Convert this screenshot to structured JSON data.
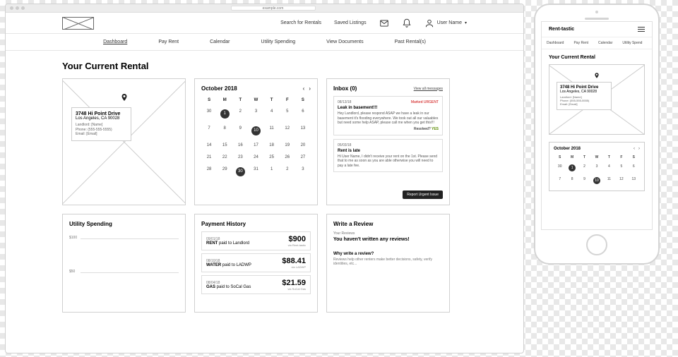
{
  "browser": {
    "url": "example.com"
  },
  "topnav": {
    "search": "Search for Rentals",
    "saved": "Saved Listings",
    "user": "User Name"
  },
  "subnav": [
    "Dashboard",
    "Pay Rent",
    "Calendar",
    "Utility Spending",
    "View Documents",
    "Past Rental(s)"
  ],
  "heading": "Your Current Rental",
  "address": {
    "line1": "3748 Hi Point Drive",
    "line2": "Los Angeles, CA 90028",
    "landlord": "Landlord: [Name]",
    "phone": "Phone: (555-555-5555)",
    "email": "Email: [Email]"
  },
  "calendar": {
    "month": "October 2018",
    "dow": [
      "S",
      "M",
      "T",
      "W",
      "T",
      "F",
      "S"
    ],
    "rows": [
      [
        "30",
        "1",
        "2",
        "3",
        "4",
        "5",
        "6"
      ],
      [
        "7",
        "8",
        "9",
        "10",
        "11",
        "12",
        "13"
      ],
      [
        "14",
        "15",
        "16",
        "17",
        "18",
        "19",
        "20"
      ],
      [
        "21",
        "22",
        "23",
        "24",
        "25",
        "26",
        "27"
      ],
      [
        "28",
        "29",
        "30",
        "31",
        "1",
        "2",
        "3"
      ]
    ],
    "marked": [
      "1",
      "10",
      "30"
    ]
  },
  "inbox": {
    "title": "Inbox (0)",
    "viewall": "View all messages",
    "msgs": [
      {
        "date": "08/13/18",
        "tag": "Marked URGENT",
        "subj": "Leak in basement!!!",
        "body": "Hey Landlord, please respond ASAP we have a leak in our basement it's flooding everywhere. We took out all our valuables but need some help ASAP, please call me when you get this!!!",
        "resolved": "Resolved? YES"
      },
      {
        "date": "05/03/18",
        "tag": "",
        "subj": "Rent is late",
        "body": "Hi User Name, I didn't receive your rent on the 1st. Please send that to me as soon as you are able otherwise you will need to pay a late fee.",
        "resolved": ""
      }
    ],
    "button": "Report Urgent Issue"
  },
  "utility": {
    "title": "Utility Spending",
    "yticks": [
      "$100",
      "$50"
    ]
  },
  "payments": {
    "title": "Payment History",
    "items": [
      {
        "date": "09/01/18",
        "cat": "RENT",
        "to": "Landlord",
        "amt": "$900",
        "via": "via Rent-tastic"
      },
      {
        "date": "08/10/18",
        "cat": "WATER",
        "to": "LADWP",
        "amt": "$88.41",
        "via": "via LADWP"
      },
      {
        "date": "08/04/18",
        "cat": "GAS",
        "to": "SoCal Gas",
        "amt": "$21.59",
        "via": "via SoCal Gas"
      }
    ]
  },
  "review": {
    "title": "Write a Review",
    "lbl": "Your Reviews",
    "none": "You haven't written any reviews!",
    "why": "Why write a review?",
    "desc": "Reviews help other renters make better decisions, safety, verify identities, etc..."
  },
  "phone": {
    "brand": "Rent-tastic",
    "tabs": [
      "Dashboard",
      "Pay Rent",
      "Calendar",
      "Utility Spend"
    ]
  }
}
